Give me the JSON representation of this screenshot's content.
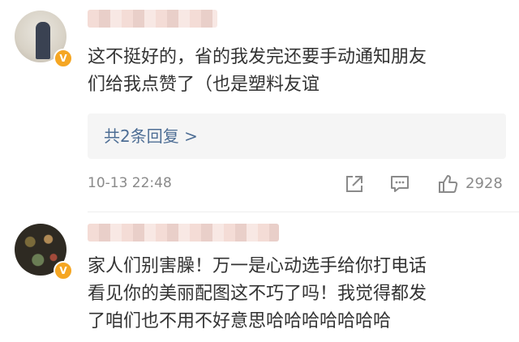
{
  "comments": [
    {
      "text_line1": "这不挺好的，省的我发完还要手动通知朋友",
      "text_line2": "们给我点赞了（也是塑料友谊",
      "reply_link": "共2条回复 >",
      "time": "10-13 22:48",
      "likes": "2928",
      "badge": "V"
    },
    {
      "text_line1": "家人们别害臊！万一是心动选手给你打电话",
      "text_line2": "看见你的美丽配图这不巧了吗！我觉得都发",
      "text_line3": "了咱们也不用不好意思哈哈哈哈哈哈哈",
      "badge": "V"
    }
  ],
  "icons": {
    "share": "share-icon",
    "comment": "comment-icon",
    "like": "thumbs-up-icon"
  },
  "colors": {
    "link": "#4e6e95",
    "meta": "#8a8a8a",
    "badge": "#f5a623"
  }
}
